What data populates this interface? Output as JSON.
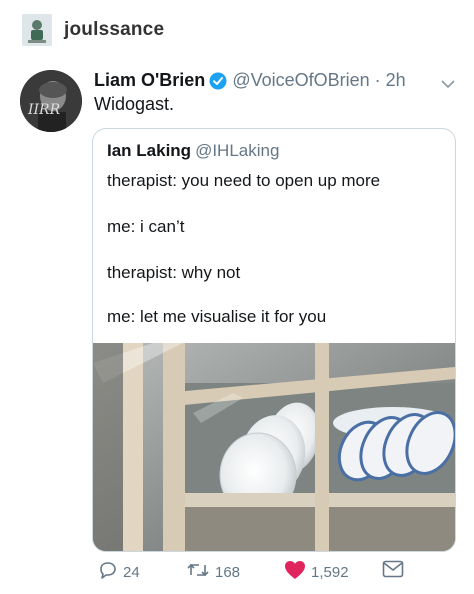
{
  "post": {
    "username": "joulssance",
    "avatar_icon": "tumblr-avatar-icon"
  },
  "tweet": {
    "display_name": "Liam O'Brien",
    "handle": "@VoiceOfOBrien",
    "time": "2h",
    "text": "Widogast.",
    "verified_icon": "verified-badge-icon",
    "caret_icon": "chevron-down-icon",
    "colors": {
      "verified": "#1da1f2",
      "like": "#e0245e",
      "text_secondary": "#657786"
    }
  },
  "quote": {
    "display_name": "Ian Laking",
    "handle": "@IHLaking",
    "lines": [
      "therapist: you need to open up more",
      "me: i can’t",
      "therapist: why not",
      "me: let me visualise it for you"
    ],
    "image_description_icon": "cabinet-plates-photo"
  },
  "actions": {
    "replies": "24",
    "retweets": "168",
    "likes": "1,592",
    "icons": [
      "reply-icon",
      "retweet-icon",
      "heart-icon",
      "message-icon"
    ]
  }
}
